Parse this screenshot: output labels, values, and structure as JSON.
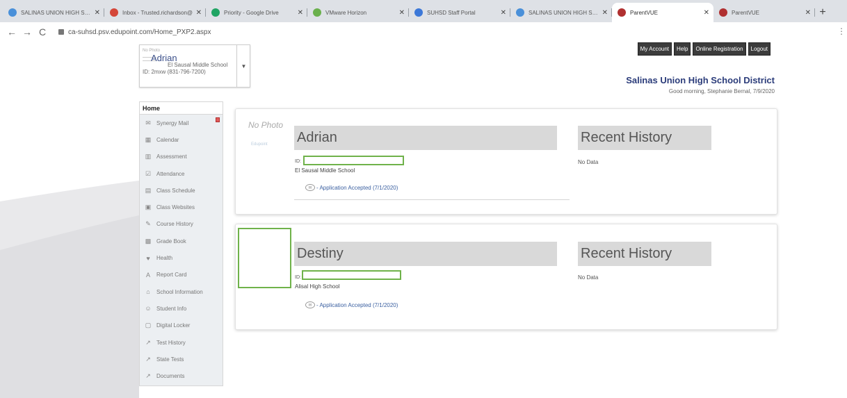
{
  "tabs": [
    {
      "title": "SALINAS UNION HIGH SCH",
      "color": "#4a90d9"
    },
    {
      "title": "Inbox - Trusted.richardson@",
      "color": "#d44638"
    },
    {
      "title": "Priority - Google Drive",
      "color": "#1fa463"
    },
    {
      "title": "VMware Horizon",
      "color": "#6ab04c"
    },
    {
      "title": "SUHSD Staff Portal",
      "color": "#3c78d8"
    },
    {
      "title": "SALINAS UNION HIGH SCH",
      "color": "#4a90d9"
    },
    {
      "title": "ParentVUE",
      "color": "#b03030",
      "active": true
    },
    {
      "title": "ParentVUE",
      "color": "#b03030"
    }
  ],
  "browser": {
    "url": "ca-suhsd.psv.edupoint.com/Home_PXP2.aspx"
  },
  "selector": {
    "no_photo": "No Photo",
    "name": "Adrian",
    "school": "El Sausal Middle School",
    "phone_prefix": "ID: 2mxw",
    "phone": "(831-796-7200)"
  },
  "topbar": {
    "buttons": [
      "My Account",
      "Help",
      "Online Registration",
      "Logout"
    ],
    "district": "Salinas Union High School District",
    "greeting": "Good morning, Stephanie Bernal, 7/9/2020"
  },
  "nav": {
    "home": "Home",
    "items": [
      {
        "label": "Synergy Mail",
        "icon": "mail-icon",
        "glyph": "✉",
        "badge": true
      },
      {
        "label": "Calendar",
        "icon": "calendar-icon",
        "glyph": "▦"
      },
      {
        "label": "Assessment",
        "icon": "assessment-icon",
        "glyph": "▥"
      },
      {
        "label": "Attendance",
        "icon": "attendance-icon",
        "glyph": "☑"
      },
      {
        "label": "Class Schedule",
        "icon": "schedule-icon",
        "glyph": "▤"
      },
      {
        "label": "Class Websites",
        "icon": "websites-icon",
        "glyph": "▣"
      },
      {
        "label": "Course History",
        "icon": "course-history-icon",
        "glyph": "✎"
      },
      {
        "label": "Grade Book",
        "icon": "gradebook-icon",
        "glyph": "▩"
      },
      {
        "label": "Health",
        "icon": "health-icon",
        "glyph": "♥"
      },
      {
        "label": "Report Card",
        "icon": "report-card-icon",
        "glyph": "A"
      },
      {
        "label": "School Information",
        "icon": "school-icon",
        "glyph": "⌂"
      },
      {
        "label": "Student Info",
        "icon": "student-info-icon",
        "glyph": "☺"
      },
      {
        "label": "Digital Locker",
        "icon": "locker-icon",
        "glyph": "▢"
      },
      {
        "label": "Test History",
        "icon": "test-history-icon",
        "glyph": "↗"
      },
      {
        "label": "State Tests",
        "icon": "state-tests-icon",
        "glyph": "↗"
      },
      {
        "label": "Documents",
        "icon": "documents-icon",
        "glyph": "↗"
      }
    ]
  },
  "students": [
    {
      "no_photo": "No Photo",
      "logo": "Edupoint",
      "name": "Adrian",
      "id_label": "ID:",
      "school": "El Sausal Middle School",
      "application": "- Application Accepted (7/1/2020)",
      "history_title": "Recent History",
      "history_value": "No Data"
    },
    {
      "name": "Destiny",
      "id_label": "ID:",
      "school": "Alisal High School",
      "application": "- Application Accepted (7/1/2020)",
      "history_title": "Recent History",
      "history_value": "No Data"
    }
  ],
  "colors": {
    "highlight_box": "#6fb24a",
    "district": "#2b3c7a",
    "link": "#3a5fa0"
  }
}
